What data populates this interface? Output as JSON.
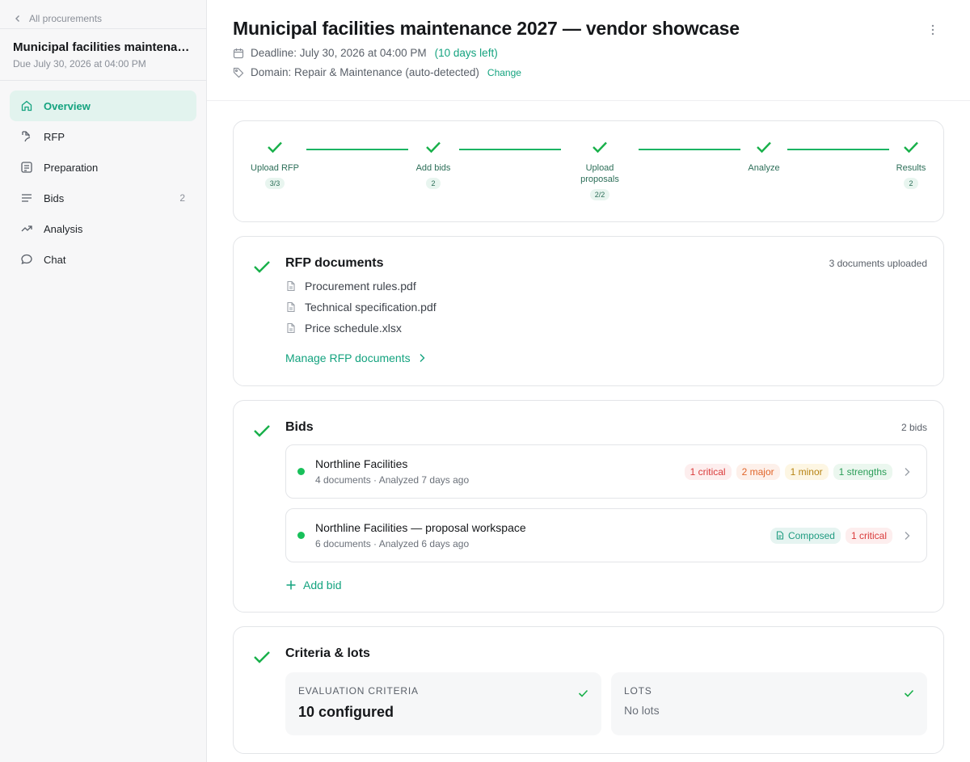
{
  "sidebar": {
    "back_label": "All procurements",
    "procurement_title": "Municipal facilities maintenance 2027 — vendor showcase",
    "procurement_due": "Due July 30, 2026 at 04:00 PM",
    "nav": [
      {
        "label": "Overview",
        "icon": "home-icon",
        "active": true
      },
      {
        "label": "RFP",
        "icon": "rfp-icon"
      },
      {
        "label": "Preparation",
        "icon": "preparation-icon"
      },
      {
        "label": "Bids",
        "icon": "list-icon",
        "count": "2"
      },
      {
        "label": "Analysis",
        "icon": "trend-icon"
      },
      {
        "label": "Chat",
        "icon": "chat-icon"
      }
    ]
  },
  "header": {
    "title": "Municipal facilities maintenance 2027 — vendor showcase",
    "deadline": "Deadline: July 30, 2026 at 04:00 PM",
    "days_left": "(10 days left)",
    "domain": "Domain: Repair & Maintenance (auto-detected)",
    "change_label": "Change"
  },
  "stepper": {
    "steps": [
      {
        "label": "Upload RFP",
        "badge": "3/3"
      },
      {
        "label": "Add bids",
        "badge": "2"
      },
      {
        "label": "Upload proposals",
        "badge": "2/2"
      },
      {
        "label": "Analyze",
        "badge": ""
      },
      {
        "label": "Results",
        "badge": "2"
      }
    ]
  },
  "rfp": {
    "title": "RFP documents",
    "summary": "3 documents uploaded",
    "documents": [
      "Procurement rules.pdf",
      "Technical specification.pdf",
      "Price schedule.xlsx"
    ],
    "manage_label": "Manage RFP documents"
  },
  "bids": {
    "title": "Bids",
    "summary": "2 bids",
    "items": [
      {
        "name": "Northline Facilities",
        "sub": "4 documents · Analyzed 7 days ago",
        "tags": {
          "critical": "1 critical",
          "major": "2 major",
          "minor": "1 minor",
          "strengths": "1 strengths"
        }
      },
      {
        "name": "Northline Facilities — proposal workspace",
        "sub": "6 documents · Analyzed 6 days ago",
        "tags": {
          "composed": "Composed",
          "critical": "1 critical"
        }
      }
    ],
    "add_label": "Add bid"
  },
  "criteria": {
    "title": "Criteria & lots",
    "evaluation": {
      "label": "EVALUATION CRITERIA",
      "value": "10 configured"
    },
    "lots": {
      "label": "LOTS",
      "value": "No lots"
    }
  },
  "colors": {
    "accent": "#14a37f",
    "check": "#18b04a",
    "active_bg": "#e2f3ee"
  }
}
